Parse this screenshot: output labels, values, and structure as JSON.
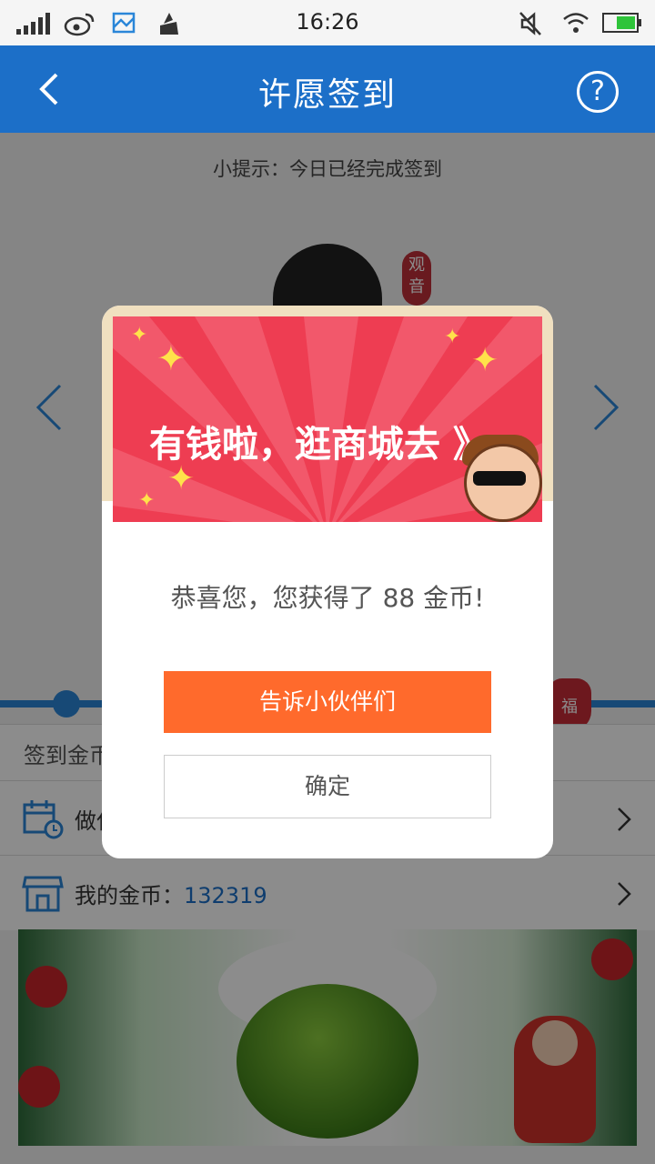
{
  "status_bar": {
    "time": "16:26"
  },
  "header": {
    "title": "许愿签到"
  },
  "tip": "小提示：今日已经完成签到",
  "badge": {
    "deity_line1": "观",
    "deity_line2": "音",
    "fortune": "福"
  },
  "rows": {
    "checkin_label": "签到金币",
    "task_label": "做任务",
    "coins_label": "我的金币：",
    "coins_value": "132319"
  },
  "dialog": {
    "banner_text": "有钱啦，逛商城去 》",
    "message": "恭喜您，您获得了 88 金币!",
    "share_button": "告诉小伙伴们",
    "confirm_button": "确定"
  },
  "colors": {
    "header": "#1c6fc8",
    "accent_orange": "#ff6a2c",
    "promo_red": "#ee3d52",
    "coin_value": "#1c6fc8"
  }
}
